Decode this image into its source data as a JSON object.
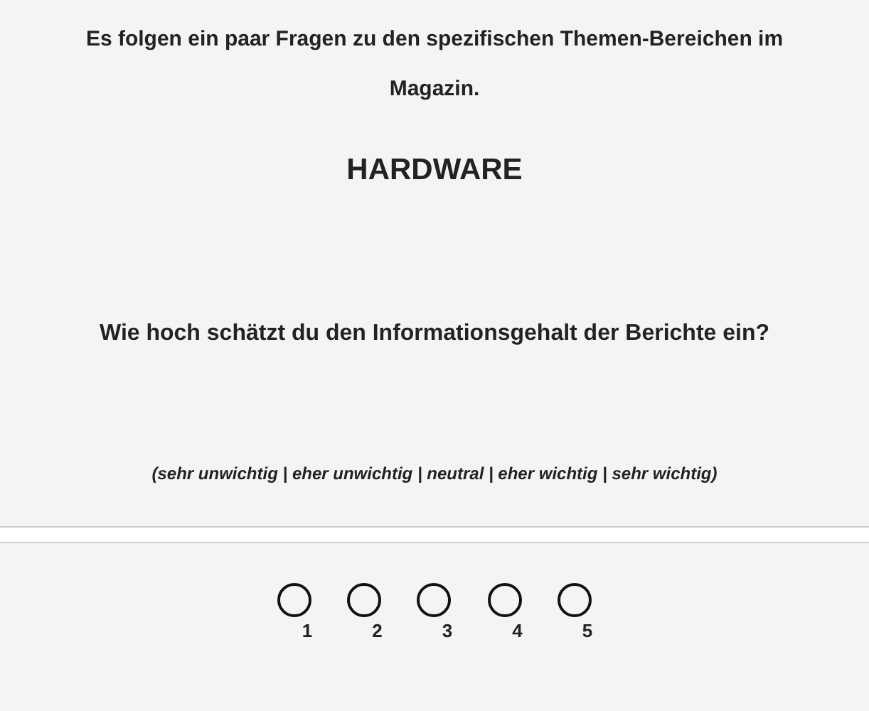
{
  "intro": "Es folgen ein paar Fragen zu den spezifischen Themen-Bereichen im Magazin.",
  "section_title": "HARDWARE",
  "question": "Wie hoch schätzt du den Informationsgehalt der Berichte ein?",
  "scale_hint": "(sehr unwichtig | eher unwichtig | neutral | eher wichtig | sehr wichtig)",
  "options": [
    {
      "label": "1",
      "selected": false
    },
    {
      "label": "2",
      "selected": false
    },
    {
      "label": "3",
      "selected": false
    },
    {
      "label": "4",
      "selected": false
    },
    {
      "label": "5",
      "selected": false
    }
  ]
}
